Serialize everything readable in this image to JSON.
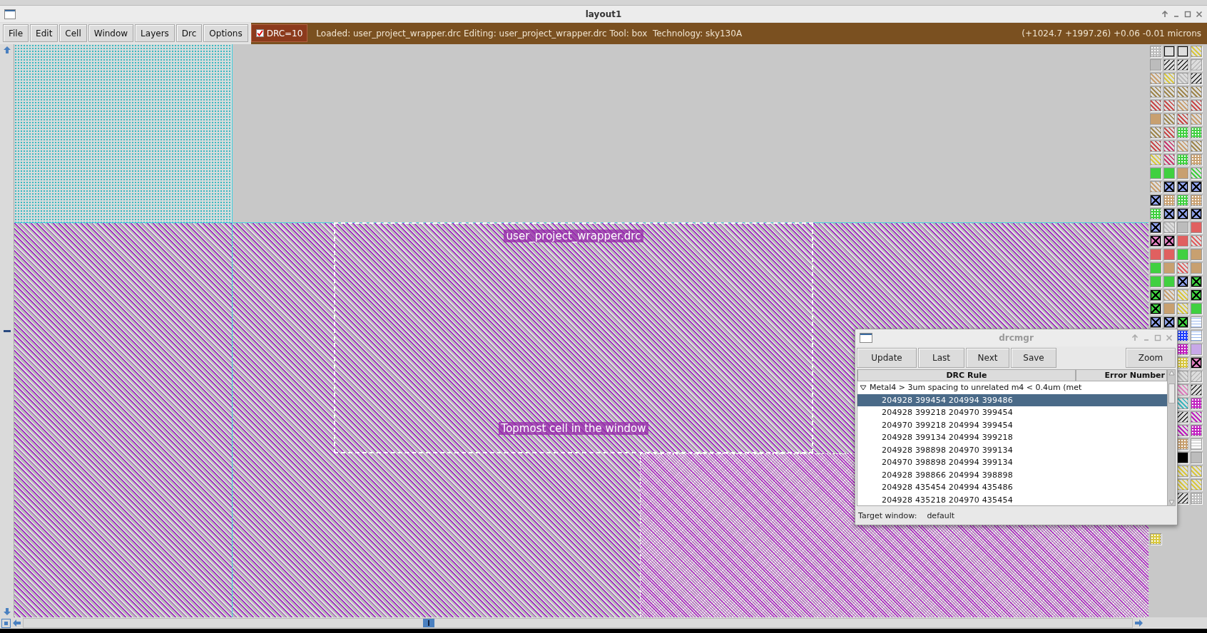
{
  "window": {
    "title": "layout1"
  },
  "menu": [
    "File",
    "Edit",
    "Cell",
    "Window",
    "Layers",
    "Drc",
    "Options"
  ],
  "drc_toggle": {
    "label": "DRC=10",
    "checked": true
  },
  "status": {
    "message": "Loaded: user_project_wrapper.drc Editing: user_project_wrapper.drc Tool: box  Technology: sky130A",
    "coordinates": "(+1024.7 +1997.26) +0.06 -0.01 microns"
  },
  "canvas": {
    "cell_name": "user_project_wrapper.drc",
    "cell_caption": "Topmost cell in the window"
  },
  "drc_manager": {
    "title": "drcmgr",
    "buttons": [
      "Update",
      "Last",
      "Next",
      "Save",
      "Zoom"
    ],
    "columns": [
      "DRC Rule",
      "Error Number"
    ],
    "groups": [
      {
        "rule": "Metal4 > 3um spacing to unrelated m4 < 0.4um (met",
        "expanded": true,
        "errors": [
          {
            "coords": "204928 399454 204994 399486",
            "selected": true
          },
          {
            "coords": "204928 399218 204970 399454",
            "selected": false
          },
          {
            "coords": "204970 399218 204994 399454",
            "selected": false
          },
          {
            "coords": "204928 399134 204994 399218",
            "selected": false
          },
          {
            "coords": "204928 398898 204970 399134",
            "selected": false
          },
          {
            "coords": "204970 398898 204994 399134",
            "selected": false
          },
          {
            "coords": "204928 398866 204994 398898",
            "selected": false
          },
          {
            "coords": "204928 435454 204994 435486",
            "selected": false
          },
          {
            "coords": "204928 435218 204970 435454",
            "selected": false
          }
        ]
      }
    ],
    "target_window": {
      "label": "Target window:",
      "value": "default"
    }
  }
}
